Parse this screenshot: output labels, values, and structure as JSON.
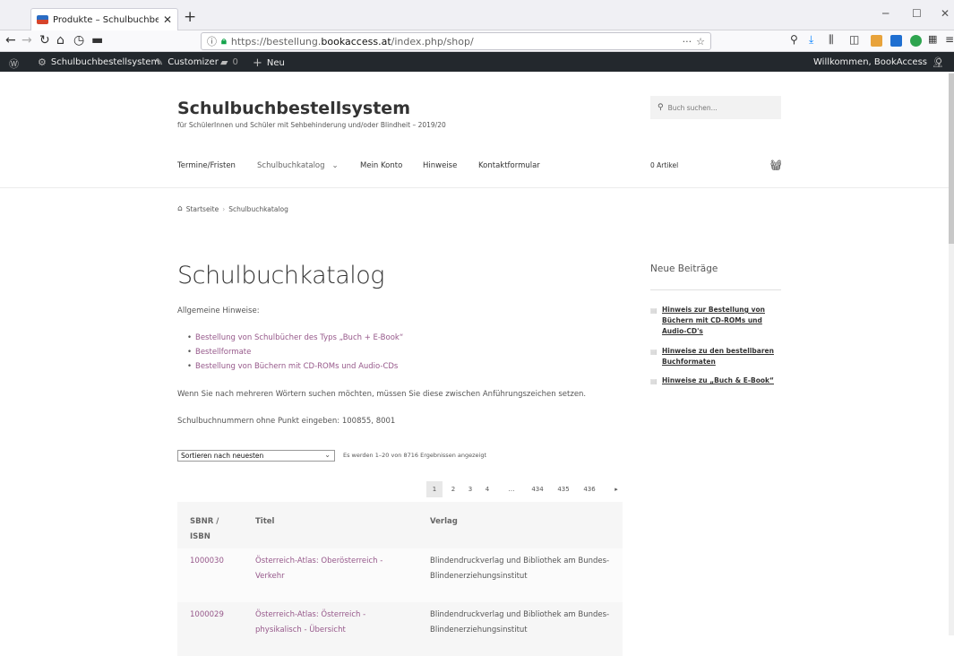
{
  "browser": {
    "tab_title": "Produkte – Schulbuchbestellsys",
    "url_prefix": "https://bestellung.",
    "url_domain": "bookaccess.at",
    "url_path": "/index.php/shop/",
    "tab_close": "✕",
    "newtab": "+"
  },
  "adminbar": {
    "site": "Schulbuchbestellsystem",
    "customizer": "Customizer",
    "comments": "0",
    "new": "Neu",
    "welcome": "Willkommen, BookAccess"
  },
  "header": {
    "title": "Schulbuchbestellsystem",
    "description": "für SchülerInnen und Schüler mit Sehbehinderung und/oder Blindheit – 2019/20",
    "search_placeholder": "Buch suchen...",
    "nav": [
      "Termine/Fristen",
      "Schulbuchkatalog",
      "Mein Konto",
      "Hinweise",
      "Kontaktformular"
    ],
    "cart": "0 Artikel"
  },
  "breadcrumb": {
    "home": "Startseite",
    "sep": "›",
    "current": "Schulbuchkatalog"
  },
  "main": {
    "title": "Schulbuchkatalog",
    "intro": "Allgemeine Hinweise:",
    "links": [
      "Bestellung von Schulbücher des Typs „Buch + E-Book“",
      "Bestellformate",
      "Bestellung von Büchern mit CD-ROMs und Audio-CDs"
    ],
    "hint1": "Wenn Sie nach mehreren Wörtern suchen möchten, müssen Sie diese zwischen Anführungszeichen setzen.",
    "hint2": "Schulbuchnummern ohne Punkt eingeben: 100855, 8001",
    "sort": "Sortieren nach neuesten",
    "result_count": "Es werden 1–20 von 8716 Ergebnissen angezeigt",
    "pagination": [
      "1",
      "2",
      "3",
      "4",
      "…",
      "434",
      "435",
      "436",
      "▸"
    ],
    "table": {
      "headers": [
        "SBNR / ISBN",
        "Titel",
        "Verlag"
      ],
      "rows": [
        {
          "sbnr": "1000030",
          "title_l1": "Österreich-Atlas: Oberösterreich -",
          "title_l2": "Verkehr",
          "verlag_l1": "Blindendruckverlag und Bibliothek am Bundes-",
          "verlag_l2": "Blindenerziehungsinstitut"
        },
        {
          "sbnr": "1000029",
          "title_l1": "Österreich-Atlas: Österreich -",
          "title_l2": "physikalisch - Übersicht",
          "verlag_l1": "Blindendruckverlag und Bibliothek am Bundes-",
          "verlag_l2": "Blindenerziehungsinstitut"
        }
      ]
    }
  },
  "sidebar": {
    "title": "Neue Beiträge",
    "items": [
      "Hinweis zur Bestellung von Büchern mit CD-ROMs und Audio-CD's",
      "Hinweise zu den bestellbaren Buchformaten",
      "Hinweise zu „Buch & E-Book“"
    ]
  },
  "colors": {
    "link": "#96588a",
    "adminbar": "#23282d"
  }
}
